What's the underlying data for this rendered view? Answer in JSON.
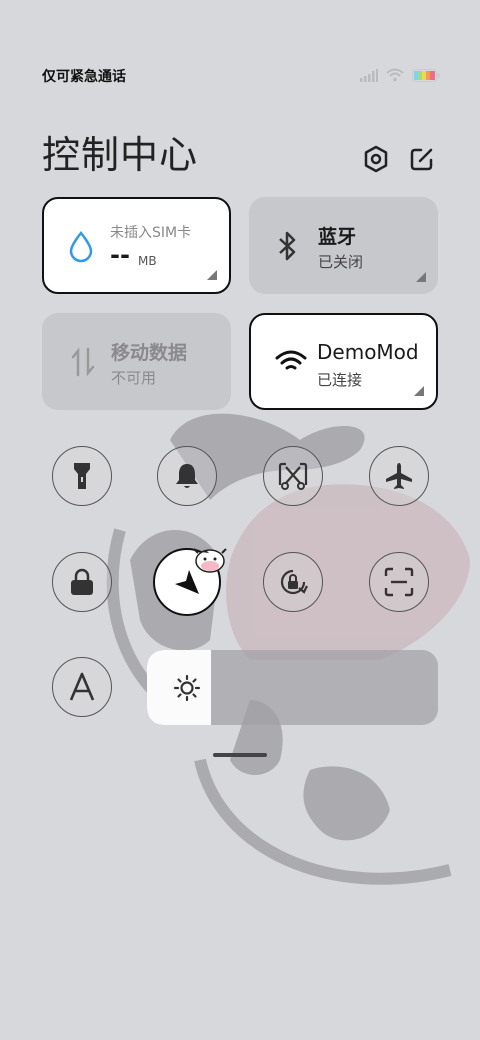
{
  "status_bar": {
    "text": "仅可紧急通话",
    "icons": [
      "signal-icon",
      "wifi-icon",
      "battery-icon"
    ]
  },
  "header": {
    "title": "控制中心",
    "settings_icon": "gear-icon",
    "edit_icon": "edit-icon"
  },
  "tiles": {
    "data_usage": {
      "label": "未插入SIM卡",
      "value": "--",
      "unit": "MB",
      "icon": "water-drop-icon",
      "active": true
    },
    "bluetooth": {
      "label": "蓝牙",
      "status": "已关闭",
      "icon": "bluetooth-icon",
      "active": false
    },
    "mobile_data": {
      "label": "移动数据",
      "status": "不可用",
      "icon": "data-arrows-icon",
      "active": false
    },
    "wifi": {
      "label": "DemoMod",
      "status": "已连接",
      "icon": "wifi-icon",
      "active": true
    }
  },
  "toggles": [
    {
      "name": "flashlight",
      "icon": "flashlight-icon",
      "active": false
    },
    {
      "name": "mute",
      "icon": "bell-icon",
      "active": false
    },
    {
      "name": "screenshot",
      "icon": "screenshot-scissors-icon",
      "active": false
    },
    {
      "name": "airplane-mode",
      "icon": "airplane-icon",
      "active": false
    },
    {
      "name": "lock-screen",
      "icon": "lock-icon",
      "active": false
    },
    {
      "name": "location",
      "icon": "location-arrow-icon",
      "active": true
    },
    {
      "name": "auto-rotate",
      "icon": "rotation-lock-icon",
      "active": false
    },
    {
      "name": "scanner",
      "icon": "scan-icon",
      "active": false
    },
    {
      "name": "reading-mode",
      "icon": "letter-a-icon",
      "active": false
    }
  ],
  "brightness": {
    "level": 0.22,
    "icon": "sun-icon"
  },
  "colors": {
    "background": "#d7d8db",
    "tile_inactive": "#c7c8cc",
    "tile_active": "#ffffff",
    "accent_blue": "#2f9ae8"
  }
}
